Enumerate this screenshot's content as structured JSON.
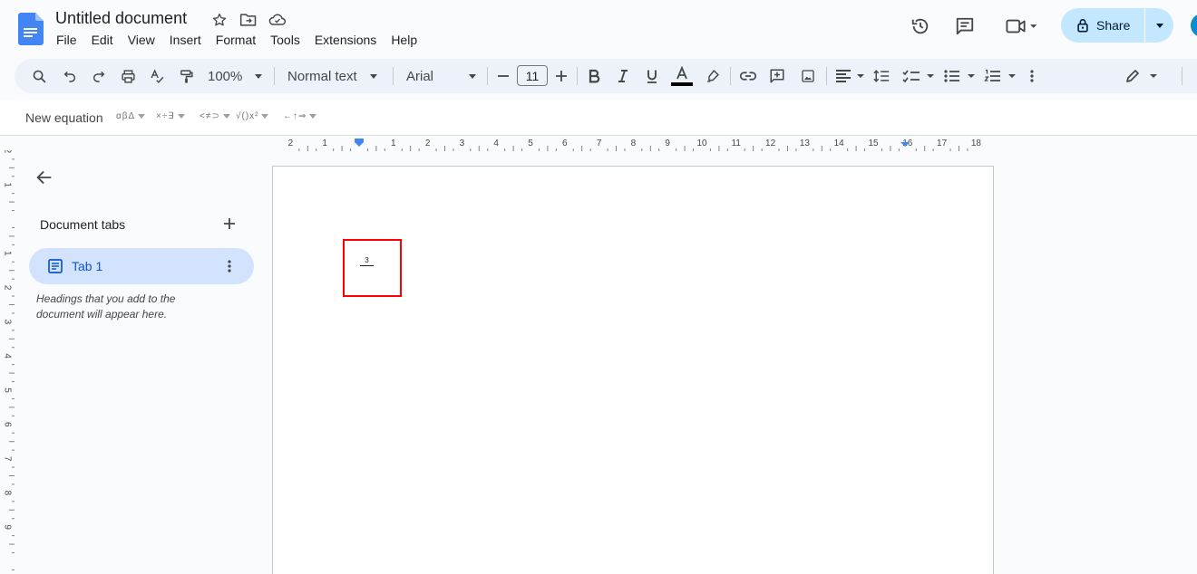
{
  "document": {
    "title": "Untitled document"
  },
  "menu": [
    "File",
    "Edit",
    "View",
    "Insert",
    "Format",
    "Tools",
    "Extensions",
    "Help"
  ],
  "header": {
    "share_label": "Share"
  },
  "toolbar": {
    "zoom": "100%",
    "style": "Normal text",
    "font": "Arial",
    "font_size": "11"
  },
  "equation_bar": {
    "new_equation": "New equation",
    "groups": [
      "αβΔ",
      "×÷∃",
      "<≠⊃",
      "√()x²",
      "←↑⇒"
    ]
  },
  "ruler": {
    "horizontal_labels": [
      "2",
      "1",
      "1",
      "2",
      "3",
      "4",
      "5",
      "6",
      "7",
      "8",
      "9",
      "10",
      "11",
      "12",
      "13",
      "14",
      "15",
      "16",
      "17",
      "18"
    ],
    "vertical_labels": [
      "2",
      "1",
      "1",
      "2",
      "3",
      "4",
      "5",
      "6",
      "7",
      "8",
      "9"
    ]
  },
  "side_panel": {
    "title": "Document tabs",
    "tabs": [
      {
        "label": "Tab 1"
      }
    ],
    "hint": "Headings that you add to the document will appear here."
  },
  "page": {
    "equation_numerator": "3"
  },
  "colors": {
    "accent": "#0b57d0",
    "share_bg": "#c2e7ff",
    "tab_bg": "#d3e3fd",
    "highlight": "#ff0000",
    "toolbar_bg": "#edf2fa"
  }
}
